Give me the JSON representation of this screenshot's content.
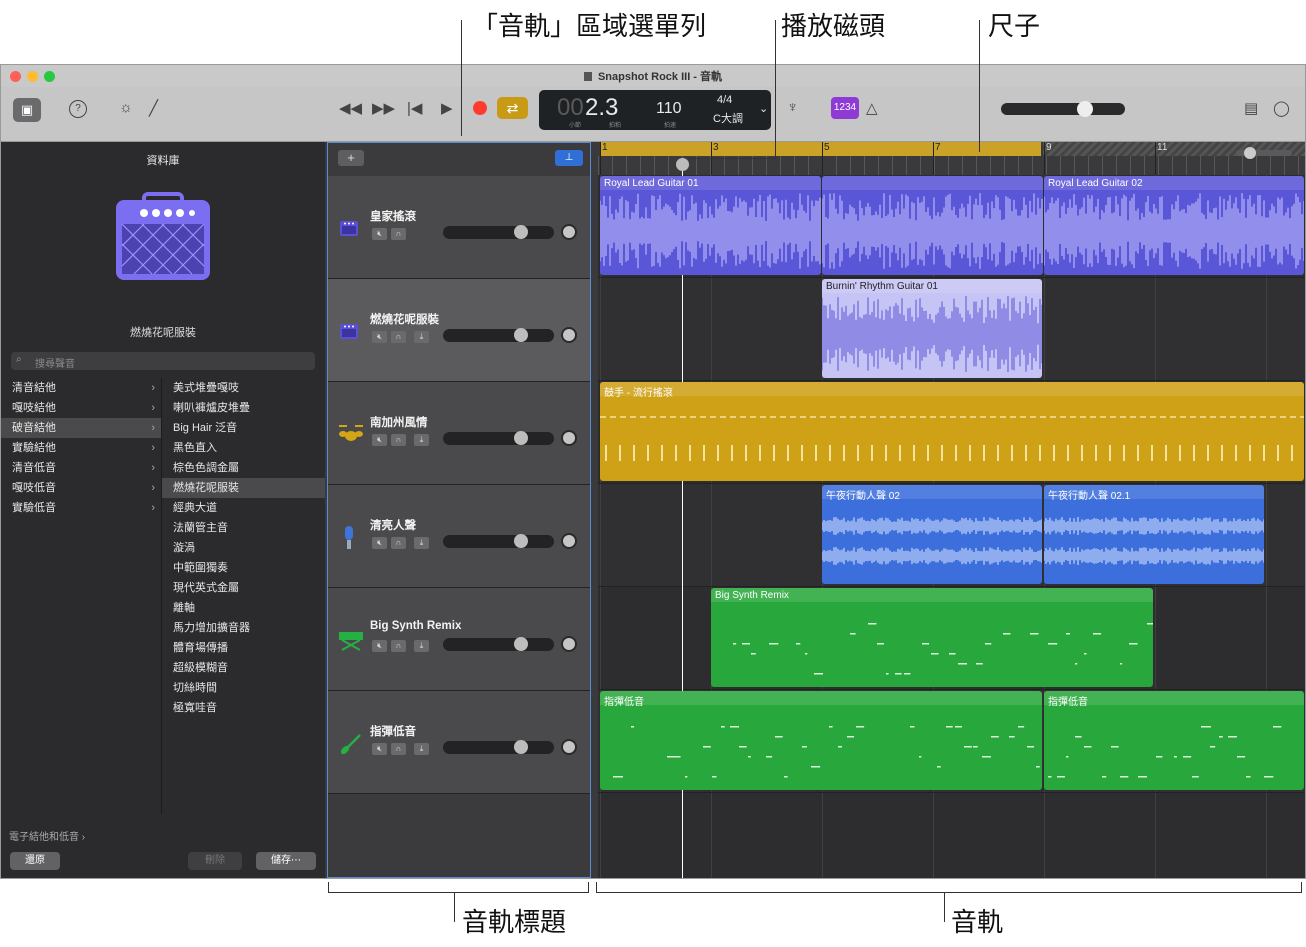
{
  "callouts": {
    "menubar": "「音軌」區域選單列",
    "playhead": "播放磁頭",
    "ruler": "尺子",
    "track_headers": "音軌標題",
    "tracks": "音軌"
  },
  "window": {
    "title": "Snapshot Rock III - 音軌"
  },
  "lcd": {
    "bar": "00",
    "beat": "2.3",
    "bar_label": "小節",
    "beat_label": "拍粕",
    "tempo": "110",
    "tempo_label": "拍速",
    "sig": "4/4",
    "key": "C大調"
  },
  "toolbar": {
    "count_in": "1234",
    "colors": {
      "record": "#ff3b30",
      "cycle": "#c99a16",
      "count_in_bg": "#8e3bd6"
    }
  },
  "library": {
    "heading": "資料庫",
    "patch_name": "燃燒花呢服裝",
    "search_placeholder": "搜尋聲音",
    "categories": [
      "清音結他",
      "嘎吱結他",
      "破音結他",
      "實驗結他",
      "清音低音",
      "嘎吱低音",
      "實驗低音"
    ],
    "selected_category": 2,
    "patches": [
      "美式堆疊嘎吱",
      "喇叭褲爐皮堆疊",
      "Big Hair 泛音",
      "黑色直入",
      "棕色色調金屬",
      "燃燒花呢服裝",
      "經典大道",
      "法蘭管主音",
      "漩渦",
      "中範圍獨奏",
      "現代英式金屬",
      "離軸",
      "馬力增加擴音器",
      "體育場傳播",
      "超級模糊音",
      "切絲時間",
      "極寬哇音"
    ],
    "selected_patch": 5,
    "footer_path": "電子結他和低音 ›",
    "revert": "還原",
    "delete": "刪除",
    "save": "儲存⋯"
  },
  "tracks": [
    {
      "name": "皇家搖滾",
      "icon": "amp-icon",
      "color": "#5a4fd6"
    },
    {
      "name": "燃燒花呢服裝",
      "icon": "amp-icon",
      "color": "#5a4fd6"
    },
    {
      "name": "南加州風情",
      "icon": "drum-kit-icon",
      "color": "#d4a616"
    },
    {
      "name": "清亮人聲",
      "icon": "microphone-icon",
      "color": "#3e74dc"
    },
    {
      "name": "Big Synth Remix",
      "icon": "keyboard-icon",
      "color": "#25b043"
    },
    {
      "name": "指彈低音",
      "icon": "bass-guitar-icon",
      "color": "#25b043"
    }
  ],
  "ruler_bars": [
    "1",
    "3",
    "5",
    "7",
    "9",
    "11"
  ],
  "regions": [
    {
      "lane": 0,
      "name": "Royal Lead Guitar 01",
      "color": "#5a56d8",
      "wave": "#c9c6ff"
    },
    {
      "lane": 0,
      "name": "",
      "color": "#5a56d8",
      "wave": "#c9c6ff"
    },
    {
      "lane": 0,
      "name": "Royal Lead Guitar 02",
      "color": "#5a56d8",
      "wave": "#c9c6ff"
    },
    {
      "lane": 1,
      "name": "Burnin' Rhythm Guitar 01",
      "color": "#c6c3f5",
      "wave": "#5a56d8"
    },
    {
      "lane": 2,
      "name": "鼓手 - 流行搖滾",
      "color": "#cfa117",
      "wave": "#f5e2a0"
    },
    {
      "lane": 3,
      "name": "午夜行動人聲 02",
      "color": "#3c6fdc",
      "wave": "#dfe8ff"
    },
    {
      "lane": 3,
      "name": "午夜行動人聲 02.1",
      "color": "#3c6fdc",
      "wave": "#dfe8ff"
    },
    {
      "lane": 4,
      "name": "Big Synth Remix",
      "color": "#28a83c",
      "wave": "#d8f5d8"
    },
    {
      "lane": 5,
      "name": "指彈低音",
      "color": "#28a83c",
      "wave": "#d8f5d8"
    },
    {
      "lane": 5,
      "name": "指彈低音",
      "color": "#28a83c",
      "wave": "#d8f5d8"
    }
  ]
}
